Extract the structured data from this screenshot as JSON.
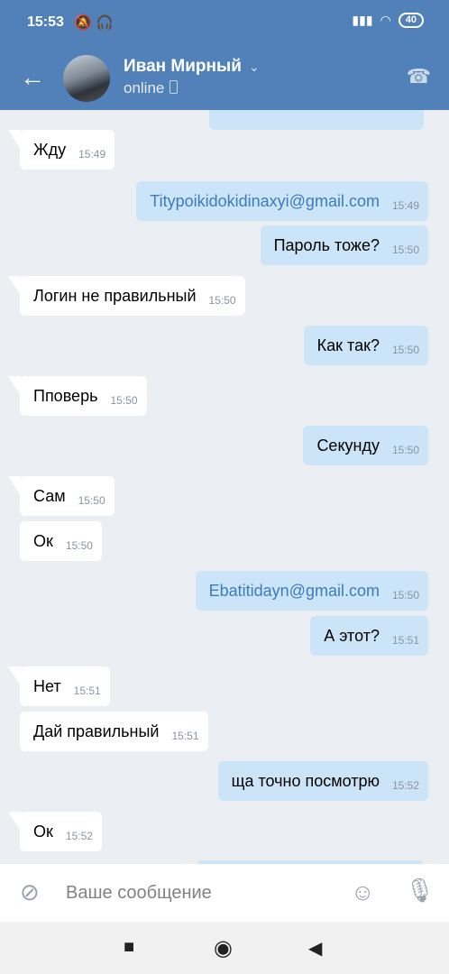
{
  "status_bar": {
    "time": "15:53",
    "icons": "🔕 🎧",
    "signal": "▮▮▮",
    "wifi": "◠",
    "battery": "40"
  },
  "header": {
    "back_icon": "←",
    "contact_name": "Иван Мирный",
    "chevron": "⌄",
    "status": "online",
    "call_icon": "☎"
  },
  "messages": [
    {
      "dir": "in",
      "text": "Жду",
      "time": "15:49"
    },
    {
      "dir": "out",
      "text": "Titypoikidokidinaxyi@gmail.com",
      "time": "15:49",
      "link": true
    },
    {
      "dir": "out",
      "text": "Пароль тоже?",
      "time": "15:50"
    },
    {
      "dir": "in",
      "text": "Логин не правильный",
      "time": "15:50"
    },
    {
      "dir": "out",
      "text": "Как так?",
      "time": "15:50"
    },
    {
      "dir": "in",
      "text": "Пповерь",
      "time": "15:50"
    },
    {
      "dir": "out",
      "text": "Секунду",
      "time": "15:50"
    },
    {
      "dir": "in",
      "text": "Сам",
      "time": "15:50"
    },
    {
      "dir": "in",
      "text": "Ок",
      "time": "15:50"
    },
    {
      "dir": "out",
      "text": "Ebatitidayn@gmail.com",
      "time": "15:50",
      "link": true
    },
    {
      "dir": "out",
      "text": "А этот?",
      "time": "15:51"
    },
    {
      "dir": "in",
      "text": "Нет",
      "time": "15:51"
    },
    {
      "dir": "in",
      "text": "Дай правильный",
      "time": "15:51"
    },
    {
      "dir": "out",
      "text": "ща точно посмотрю",
      "time": "15:52"
    },
    {
      "dir": "in",
      "text": "Ок",
      "time": "15:52"
    }
  ],
  "input": {
    "placeholder": "Ваше сообщение",
    "attach_icon": "⊘",
    "emoji_icon": "☺",
    "mic_icon": "🎙"
  },
  "nav": {
    "recent": "■",
    "home": "◉",
    "back": "◀"
  }
}
